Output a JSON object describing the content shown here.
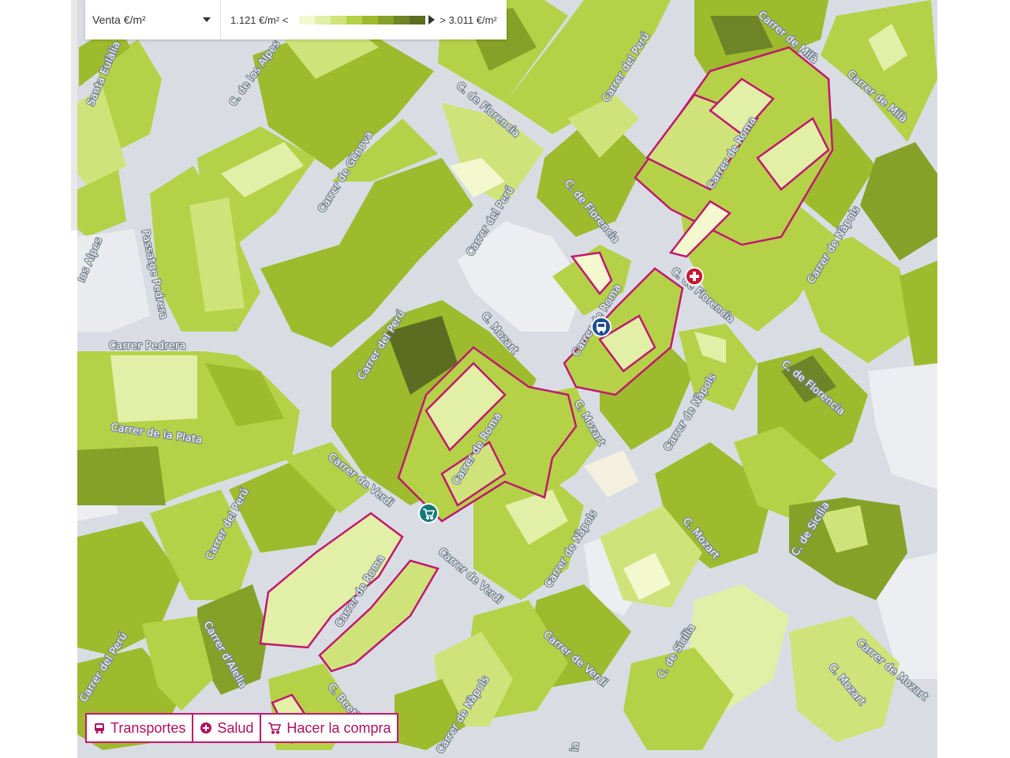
{
  "legend": {
    "select_label": "Venta €/m²",
    "min_label": "1.121 €/m² <",
    "max_label": "> 3.011 €/m²",
    "ramp_colors": [
      "#f3f8cf",
      "#e2efa6",
      "#cfe37a",
      "#b5d147",
      "#9dbb2d",
      "#86a127",
      "#6f8426",
      "#5c6d22"
    ]
  },
  "poi_buttons": [
    {
      "label": "Transportes",
      "icon": "bus-icon"
    },
    {
      "label": "Salud",
      "icon": "plus-circle-icon"
    },
    {
      "label": "Hacer la compra",
      "icon": "cart-icon"
    }
  ],
  "markers": [
    {
      "name": "health-marker",
      "icon": "plus-icon",
      "color": "#c5162e"
    },
    {
      "name": "bus-marker",
      "icon": "bus-icon",
      "color": "#1c4f91"
    },
    {
      "name": "shop-marker",
      "icon": "cart-icon",
      "color": "#117a79"
    }
  ],
  "streets": [
    {
      "name": "Santa Eulàlia"
    },
    {
      "name": "C. de los Alpes"
    },
    {
      "name": "Carrer de Gènova"
    },
    {
      "name": "C. de Florencia"
    },
    {
      "name": "Carrer del Perú"
    },
    {
      "name": "Carrer del Perú"
    },
    {
      "name": "C. de Florencia"
    },
    {
      "name": "Carrer de Roma"
    },
    {
      "name": "Carrer de Milà"
    },
    {
      "name": "Carrer de Milà"
    },
    {
      "name": "Passatge Pedrera"
    },
    {
      "name": "los Alpes"
    },
    {
      "name": "Carrer Pedrera"
    },
    {
      "name": "Carrer del Perú"
    },
    {
      "name": "C. Mozart"
    },
    {
      "name": "Carrer de Roma"
    },
    {
      "name": "C. de Florencia"
    },
    {
      "name": "Carrer de Nàpols"
    },
    {
      "name": "C. de Florencia"
    },
    {
      "name": "Carrer de la Plata"
    },
    {
      "name": "Carrer de Verdi"
    },
    {
      "name": "Carrer de Roma"
    },
    {
      "name": "C. Mozart"
    },
    {
      "name": "Carrer de Nàpols"
    },
    {
      "name": "C. de Sicília"
    },
    {
      "name": "Carrer del Perú"
    },
    {
      "name": "Carrer de Roma"
    },
    {
      "name": "Carrer de Verdi"
    },
    {
      "name": "Carrer de Nàpols"
    },
    {
      "name": "C. Mozart"
    },
    {
      "name": "Carrer d'Alella"
    },
    {
      "name": "Carrer del Perú"
    },
    {
      "name": "C. Beeth"
    },
    {
      "name": "Carrer de Nàpols"
    },
    {
      "name": "Carrer de Verdi"
    },
    {
      "name": "C. de Sicília"
    },
    {
      "name": "Carrer de Mozart"
    },
    {
      "name": "C. Mozart"
    },
    {
      "name": "ia"
    }
  ],
  "colors": {
    "road": "#d9dde3",
    "highlight_outline": "#c0186f",
    "accent_text": "#b0105e"
  }
}
